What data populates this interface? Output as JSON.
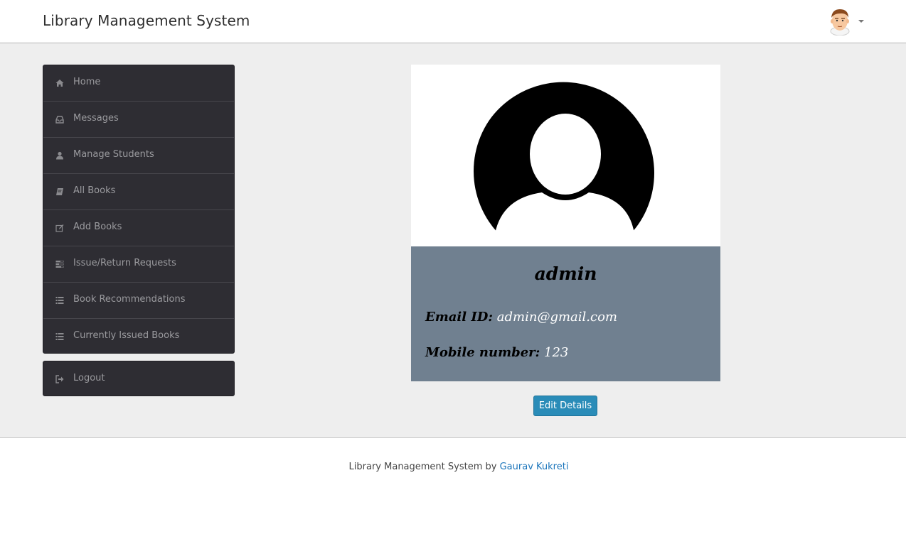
{
  "app": {
    "title": "Library Management System"
  },
  "user_menu": {
    "avatar_icon": "cartoon-man-avatar-icon",
    "caret_icon": "caret-down-icon"
  },
  "sidebar": {
    "items": [
      {
        "label": "Home",
        "icon": "home-icon"
      },
      {
        "label": "Messages",
        "icon": "inbox-icon"
      },
      {
        "label": "Manage Students",
        "icon": "user-icon"
      },
      {
        "label": "All Books",
        "icon": "book-icon"
      },
      {
        "label": "Add Books",
        "icon": "edit-icon"
      },
      {
        "label": "Issue/Return Requests",
        "icon": "tasks-icon"
      },
      {
        "label": "Book Recommendations",
        "icon": "list-icon"
      },
      {
        "label": "Currently Issued Books",
        "icon": "list-icon"
      }
    ],
    "logout": {
      "label": "Logout",
      "icon": "sign-out-icon"
    }
  },
  "profile": {
    "username": "admin",
    "email_label": "Email ID:",
    "email": "admin@gmail.com",
    "mobile_label": "Mobile number:",
    "mobile": "123",
    "edit_button": "Edit Details",
    "colors": {
      "info_background": "#708090",
      "edit_button": "#2a8cb8"
    }
  },
  "footer": {
    "text": "Library Management System by",
    "author": "Gaurav Kukreti"
  }
}
